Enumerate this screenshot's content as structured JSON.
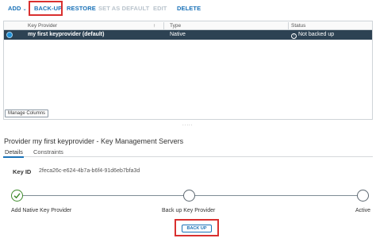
{
  "toolbar": {
    "add_label": "ADD",
    "add_chevron": "⌄",
    "backup_label": "BACK-UP",
    "restore_label": "RESTORE",
    "set_default_label": "SET AS DEFAULT",
    "edit_label": "EDIT",
    "delete_label": "DELETE"
  },
  "grid": {
    "columns": [
      "Key Provider",
      "Type",
      "Status"
    ],
    "sort_indicator": "↑",
    "rows": [
      {
        "key_provider": "my first keyprovider (default)",
        "type": "Native",
        "status": "Not backed up",
        "status_icon": "!"
      }
    ],
    "manage_columns_label": "Manage Columns",
    "splitter_glyph": "....."
  },
  "details": {
    "title": "Provider my first keyprovider - Key Management Servers",
    "tabs": [
      "Details",
      "Constraints"
    ],
    "key_id_label": "Key ID",
    "key_id_value": "2feca26c-e624-4b7a-b6f4-91d6eb7bfa3d"
  },
  "stepper": {
    "steps": [
      {
        "label": "Add Native Key Provider",
        "done": true
      },
      {
        "label": "Back up Key Provider",
        "done": false
      },
      {
        "label": "Active",
        "done": false
      }
    ],
    "backup_button_label": "BACK UP"
  },
  "colors": {
    "accent": "#1a72b8",
    "highlight": "#d9302f",
    "selected_row": "#2d4253",
    "success": "#3e8a2c"
  }
}
